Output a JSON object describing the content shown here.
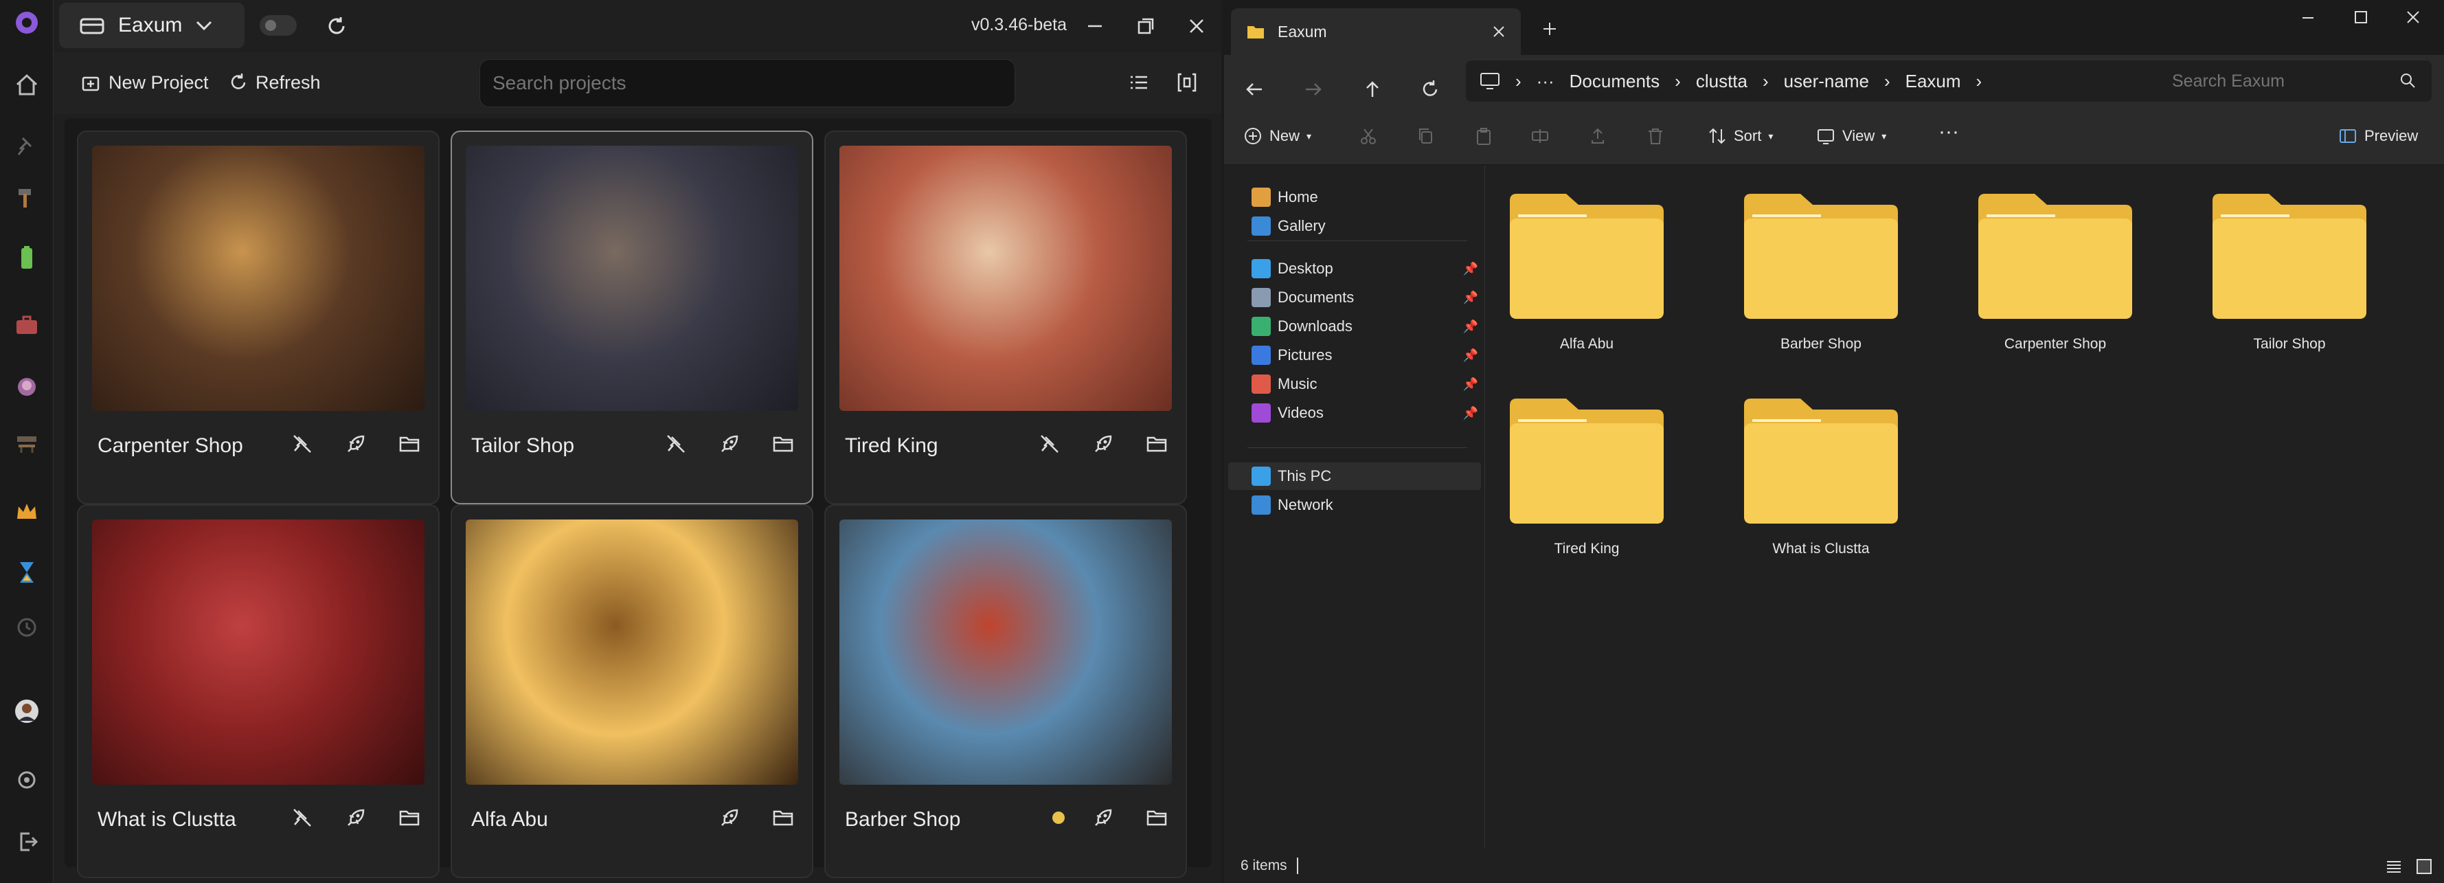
{
  "app": {
    "workspace_name": "Eaxum",
    "version": "v0.3.46-beta",
    "toolbar": {
      "new_project": "New Project",
      "refresh": "Refresh"
    },
    "search_placeholder": "Search projects",
    "rail_icons": [
      "clustta-logo-icon",
      "home-icon",
      "pin-icon",
      "hammer-icon",
      "battery-icon",
      "briefcase-icon",
      "bowl-icon",
      "sewing-machine-icon",
      "crown-icon",
      "hourglass-icon",
      "clock-icon",
      "avatar",
      "settings-icon",
      "logout-icon"
    ],
    "projects": [
      {
        "title": "Carpenter Shop",
        "selected": false,
        "status_dot": false,
        "unpinned": true,
        "colors": [
          "#5a3a24",
          "#c8944e",
          "#2b1b12"
        ]
      },
      {
        "title": "Tailor Shop",
        "selected": true,
        "status_dot": false,
        "unpinned": true,
        "colors": [
          "#3a3a48",
          "#7a6a60",
          "#1e1e26"
        ]
      },
      {
        "title": "Tired King",
        "selected": false,
        "status_dot": false,
        "unpinned": true,
        "colors": [
          "#b85c44",
          "#e8c8a8",
          "#6a2e22"
        ]
      },
      {
        "title": "What is Clustta",
        "selected": false,
        "status_dot": false,
        "unpinned": true,
        "colors": [
          "#8a2222",
          "#c04040",
          "#3a0e0e"
        ]
      },
      {
        "title": "Alfa Abu",
        "selected": false,
        "status_dot": false,
        "unpinned": false,
        "colors": [
          "#f0c060",
          "#8a5a22",
          "#3a2410"
        ]
      },
      {
        "title": "Barber Shop",
        "selected": false,
        "status_dot": true,
        "unpinned": false,
        "colors": [
          "#5a8ab0",
          "#c0442e",
          "#2a2a2a"
        ]
      }
    ]
  },
  "explorer": {
    "tab_title": "Eaxum",
    "breadcrumb": [
      "Documents",
      "clustta",
      "user-name",
      "Eaxum"
    ],
    "search_placeholder": "Search Eaxum",
    "commands": {
      "new": "New",
      "sort": "Sort",
      "view": "View",
      "preview": "Preview"
    },
    "nav_top": [
      {
        "label": "Home",
        "color": "#e0a040"
      },
      {
        "label": "Gallery",
        "color": "#3a8ad8"
      }
    ],
    "nav_quick": [
      {
        "label": "Desktop",
        "color": "#3aa0e8"
      },
      {
        "label": "Documents",
        "color": "#8a9ab0"
      },
      {
        "label": "Downloads",
        "color": "#3ab070"
      },
      {
        "label": "Pictures",
        "color": "#3a7ae0"
      },
      {
        "label": "Music",
        "color": "#e05a4a"
      },
      {
        "label": "Videos",
        "color": "#a04ad8"
      }
    ],
    "nav_bottom": [
      {
        "label": "This PC",
        "color": "#3aa0e8"
      },
      {
        "label": "Network",
        "color": "#3a8ad8"
      }
    ],
    "folders": [
      "Alfa Abu",
      "Barber Shop",
      "Carpenter Shop",
      "Tailor Shop",
      "Tired King",
      "What is Clustta"
    ],
    "status": "6 items"
  }
}
